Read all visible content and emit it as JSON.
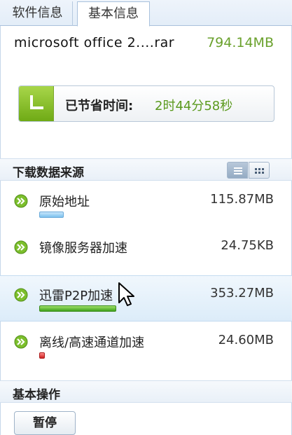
{
  "tabs": [
    {
      "label": "软件信息",
      "active": false
    },
    {
      "label": "基本信息",
      "active": true
    }
  ],
  "file": {
    "name": "microsoft office 2....rar",
    "size": "794.14MB"
  },
  "saved_time": {
    "label": "已节省时间:",
    "value": "2时44分58秒",
    "icon": "clock-icon"
  },
  "sources_section": {
    "title": "下载数据来源",
    "view_modes": [
      "list-view-icon",
      "grid-view-icon"
    ],
    "active_view": "list"
  },
  "sources": [
    {
      "name": "原始地址",
      "size": "115.87MB",
      "bar_color": "blue",
      "progress": 0.14
    },
    {
      "name": "镜像服务器加速",
      "size": "24.75KB",
      "bar_color": "none",
      "progress": 0.0
    },
    {
      "name": "迅雷P2P加速",
      "size": "353.27MB",
      "bar_color": "green",
      "progress": 0.44,
      "selected": true
    },
    {
      "name": "离线/高速通道加速",
      "size": "24.60MB",
      "bar_color": "red",
      "progress": 0.03
    }
  ],
  "operations_section": {
    "title": "基本操作"
  },
  "pause_button": {
    "label": "暂停"
  },
  "colors": {
    "accent_green": "#6aa12c",
    "blue_bar": "#7cc1ee",
    "green_bar": "#3fa21c",
    "red_bar": "#cc2020"
  }
}
